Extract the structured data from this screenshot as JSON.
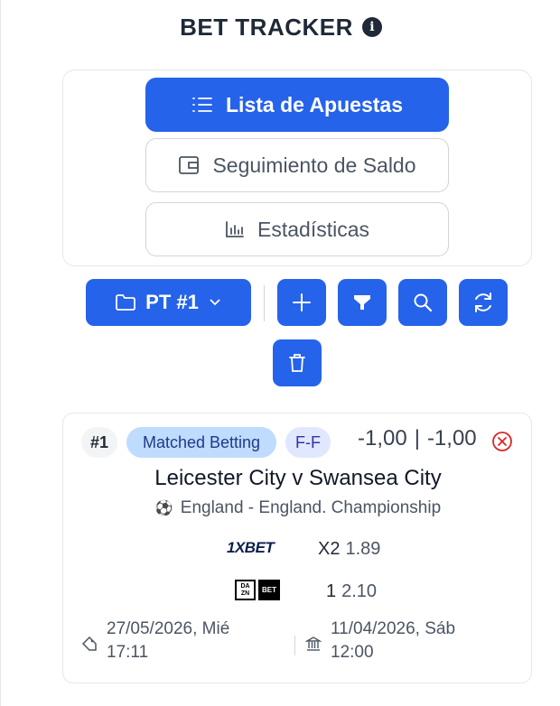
{
  "header": {
    "title": "BET TRACKER",
    "info_icon": "info-icon"
  },
  "nav": {
    "items": [
      {
        "label": "Lista de Apuestas",
        "icon": "list-icon",
        "active": true
      },
      {
        "label": "Seguimiento de Saldo",
        "icon": "wallet-icon",
        "active": false
      },
      {
        "label": "Estadísticas",
        "icon": "bar-chart-icon",
        "active": false
      }
    ]
  },
  "toolbar": {
    "portfolio_label": "PT #1",
    "portfolio_icon": "folder-icon",
    "buttons": [
      "plus-icon",
      "filter-icon",
      "search-icon",
      "refresh-icon",
      "trash-icon"
    ]
  },
  "bet": {
    "number": "#1",
    "type": "Matched Betting",
    "mode": "F-F",
    "result_a": "-1,00",
    "separator": "|",
    "result_b": "-1,00",
    "status_icon": "lost-x-icon",
    "event": "Leicester City v Swansea City",
    "league": "England - England. Championship",
    "legs": [
      {
        "bookmaker": "1XBET",
        "pick": "X2",
        "odds": "1.89"
      },
      {
        "bookmaker": "DAZN BET",
        "pick": "1",
        "odds": "2.10"
      }
    ],
    "created_date": "27/05/2026, Mié",
    "created_time": "17:11",
    "event_date": "11/04/2026, Sáb",
    "event_time": "12:00"
  },
  "colors": {
    "primary": "#2563eb",
    "lost": "#dc2626"
  }
}
